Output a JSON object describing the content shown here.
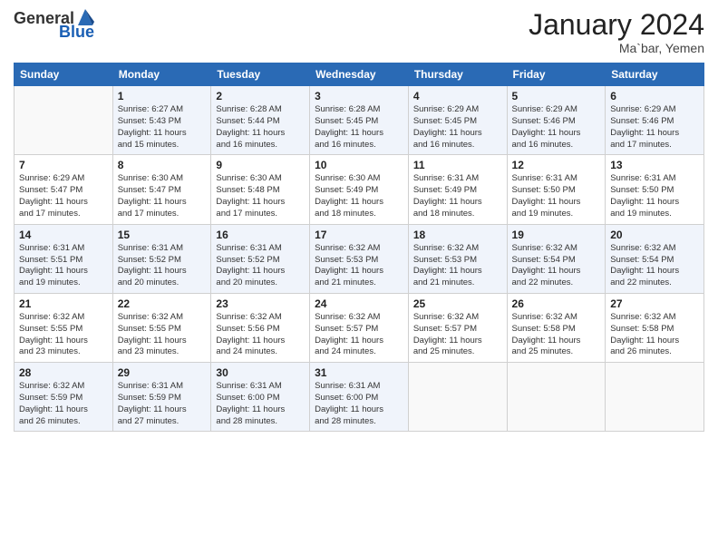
{
  "logo": {
    "general": "General",
    "blue": "Blue"
  },
  "header": {
    "month": "January 2024",
    "location": "Ma`bar, Yemen"
  },
  "days_of_week": [
    "Sunday",
    "Monday",
    "Tuesday",
    "Wednesday",
    "Thursday",
    "Friday",
    "Saturday"
  ],
  "weeks": [
    [
      {
        "num": "",
        "info": ""
      },
      {
        "num": "1",
        "info": "Sunrise: 6:27 AM\nSunset: 5:43 PM\nDaylight: 11 hours\nand 15 minutes."
      },
      {
        "num": "2",
        "info": "Sunrise: 6:28 AM\nSunset: 5:44 PM\nDaylight: 11 hours\nand 16 minutes."
      },
      {
        "num": "3",
        "info": "Sunrise: 6:28 AM\nSunset: 5:45 PM\nDaylight: 11 hours\nand 16 minutes."
      },
      {
        "num": "4",
        "info": "Sunrise: 6:29 AM\nSunset: 5:45 PM\nDaylight: 11 hours\nand 16 minutes."
      },
      {
        "num": "5",
        "info": "Sunrise: 6:29 AM\nSunset: 5:46 PM\nDaylight: 11 hours\nand 16 minutes."
      },
      {
        "num": "6",
        "info": "Sunrise: 6:29 AM\nSunset: 5:46 PM\nDaylight: 11 hours\nand 17 minutes."
      }
    ],
    [
      {
        "num": "7",
        "info": "Sunrise: 6:29 AM\nSunset: 5:47 PM\nDaylight: 11 hours\nand 17 minutes."
      },
      {
        "num": "8",
        "info": "Sunrise: 6:30 AM\nSunset: 5:47 PM\nDaylight: 11 hours\nand 17 minutes."
      },
      {
        "num": "9",
        "info": "Sunrise: 6:30 AM\nSunset: 5:48 PM\nDaylight: 11 hours\nand 17 minutes."
      },
      {
        "num": "10",
        "info": "Sunrise: 6:30 AM\nSunset: 5:49 PM\nDaylight: 11 hours\nand 18 minutes."
      },
      {
        "num": "11",
        "info": "Sunrise: 6:31 AM\nSunset: 5:49 PM\nDaylight: 11 hours\nand 18 minutes."
      },
      {
        "num": "12",
        "info": "Sunrise: 6:31 AM\nSunset: 5:50 PM\nDaylight: 11 hours\nand 19 minutes."
      },
      {
        "num": "13",
        "info": "Sunrise: 6:31 AM\nSunset: 5:50 PM\nDaylight: 11 hours\nand 19 minutes."
      }
    ],
    [
      {
        "num": "14",
        "info": "Sunrise: 6:31 AM\nSunset: 5:51 PM\nDaylight: 11 hours\nand 19 minutes."
      },
      {
        "num": "15",
        "info": "Sunrise: 6:31 AM\nSunset: 5:52 PM\nDaylight: 11 hours\nand 20 minutes."
      },
      {
        "num": "16",
        "info": "Sunrise: 6:31 AM\nSunset: 5:52 PM\nDaylight: 11 hours\nand 20 minutes."
      },
      {
        "num": "17",
        "info": "Sunrise: 6:32 AM\nSunset: 5:53 PM\nDaylight: 11 hours\nand 21 minutes."
      },
      {
        "num": "18",
        "info": "Sunrise: 6:32 AM\nSunset: 5:53 PM\nDaylight: 11 hours\nand 21 minutes."
      },
      {
        "num": "19",
        "info": "Sunrise: 6:32 AM\nSunset: 5:54 PM\nDaylight: 11 hours\nand 22 minutes."
      },
      {
        "num": "20",
        "info": "Sunrise: 6:32 AM\nSunset: 5:54 PM\nDaylight: 11 hours\nand 22 minutes."
      }
    ],
    [
      {
        "num": "21",
        "info": "Sunrise: 6:32 AM\nSunset: 5:55 PM\nDaylight: 11 hours\nand 23 minutes."
      },
      {
        "num": "22",
        "info": "Sunrise: 6:32 AM\nSunset: 5:55 PM\nDaylight: 11 hours\nand 23 minutes."
      },
      {
        "num": "23",
        "info": "Sunrise: 6:32 AM\nSunset: 5:56 PM\nDaylight: 11 hours\nand 24 minutes."
      },
      {
        "num": "24",
        "info": "Sunrise: 6:32 AM\nSunset: 5:57 PM\nDaylight: 11 hours\nand 24 minutes."
      },
      {
        "num": "25",
        "info": "Sunrise: 6:32 AM\nSunset: 5:57 PM\nDaylight: 11 hours\nand 25 minutes."
      },
      {
        "num": "26",
        "info": "Sunrise: 6:32 AM\nSunset: 5:58 PM\nDaylight: 11 hours\nand 25 minutes."
      },
      {
        "num": "27",
        "info": "Sunrise: 6:32 AM\nSunset: 5:58 PM\nDaylight: 11 hours\nand 26 minutes."
      }
    ],
    [
      {
        "num": "28",
        "info": "Sunrise: 6:32 AM\nSunset: 5:59 PM\nDaylight: 11 hours\nand 26 minutes."
      },
      {
        "num": "29",
        "info": "Sunrise: 6:31 AM\nSunset: 5:59 PM\nDaylight: 11 hours\nand 27 minutes."
      },
      {
        "num": "30",
        "info": "Sunrise: 6:31 AM\nSunset: 6:00 PM\nDaylight: 11 hours\nand 28 minutes."
      },
      {
        "num": "31",
        "info": "Sunrise: 6:31 AM\nSunset: 6:00 PM\nDaylight: 11 hours\nand 28 minutes."
      },
      {
        "num": "",
        "info": ""
      },
      {
        "num": "",
        "info": ""
      },
      {
        "num": "",
        "info": ""
      }
    ]
  ]
}
